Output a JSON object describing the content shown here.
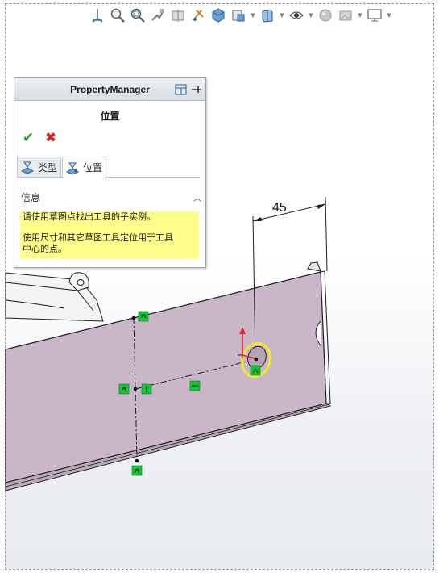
{
  "toolbar": {
    "buttons": [
      {
        "icon": "view-orientation-icon"
      },
      {
        "icon": "zoom-to-fit-icon"
      },
      {
        "icon": "zoom-to-area-icon"
      },
      {
        "icon": "previous-view-icon"
      },
      {
        "icon": "section-view-icon"
      },
      {
        "icon": "dynamic-annotation-icon"
      },
      {
        "icon": "display-style-cube-icon"
      },
      {
        "icon": "view-settings-icon"
      },
      {
        "icon": "display-style-box-icon"
      },
      {
        "icon": "hide-show-items-eye-icon"
      },
      {
        "icon": "edit-appearance-icon"
      },
      {
        "icon": "apply-scene-icon"
      },
      {
        "icon": "view-settings-monitor-icon"
      }
    ]
  },
  "property_manager": {
    "title": "PropertyManager",
    "subtitle": "位置",
    "tabs": [
      {
        "label": "类型",
        "active": false
      },
      {
        "label": "位置",
        "active": true
      }
    ],
    "info_section": {
      "title": "信息",
      "line1": "请使用草图点找出工具的子实例。",
      "line2a": "使用尺寸和其它草图工具定位用于工具",
      "line2b": "中心的点。"
    }
  },
  "drawing": {
    "dimension_value": "45",
    "colors": {
      "sheet_face": "#c9b6c8",
      "sheet_edge": "#1e1e1e",
      "constraint_green": "#17c33a",
      "highlight_yellow": "#f6e72a",
      "message_yellow": "#fdff8a"
    }
  }
}
